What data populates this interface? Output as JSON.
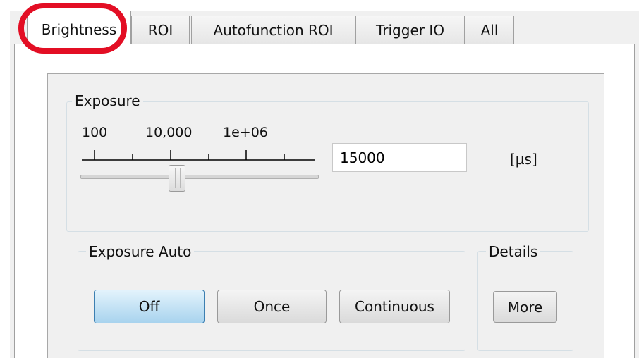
{
  "tabs": [
    {
      "label": "Brightness",
      "active": true
    },
    {
      "label": "ROI",
      "active": false
    },
    {
      "label": "Autofunction ROI",
      "active": false
    },
    {
      "label": "Trigger IO",
      "active": false
    },
    {
      "label": "All",
      "active": false
    }
  ],
  "exposure": {
    "group_label": "Exposure",
    "scale_labels": [
      "100",
      "10,000",
      "1e+06"
    ],
    "value": "15000",
    "unit": "[µs]"
  },
  "exposure_auto": {
    "group_label": "Exposure Auto",
    "buttons": [
      {
        "label": "Off",
        "pressed": true
      },
      {
        "label": "Once",
        "pressed": false
      },
      {
        "label": "Continuous",
        "pressed": false
      }
    ]
  },
  "details": {
    "group_label": "Details",
    "button_label": "More"
  },
  "colors": {
    "highlight": "#e30e24",
    "pressed_button": "#a8d3ee"
  }
}
